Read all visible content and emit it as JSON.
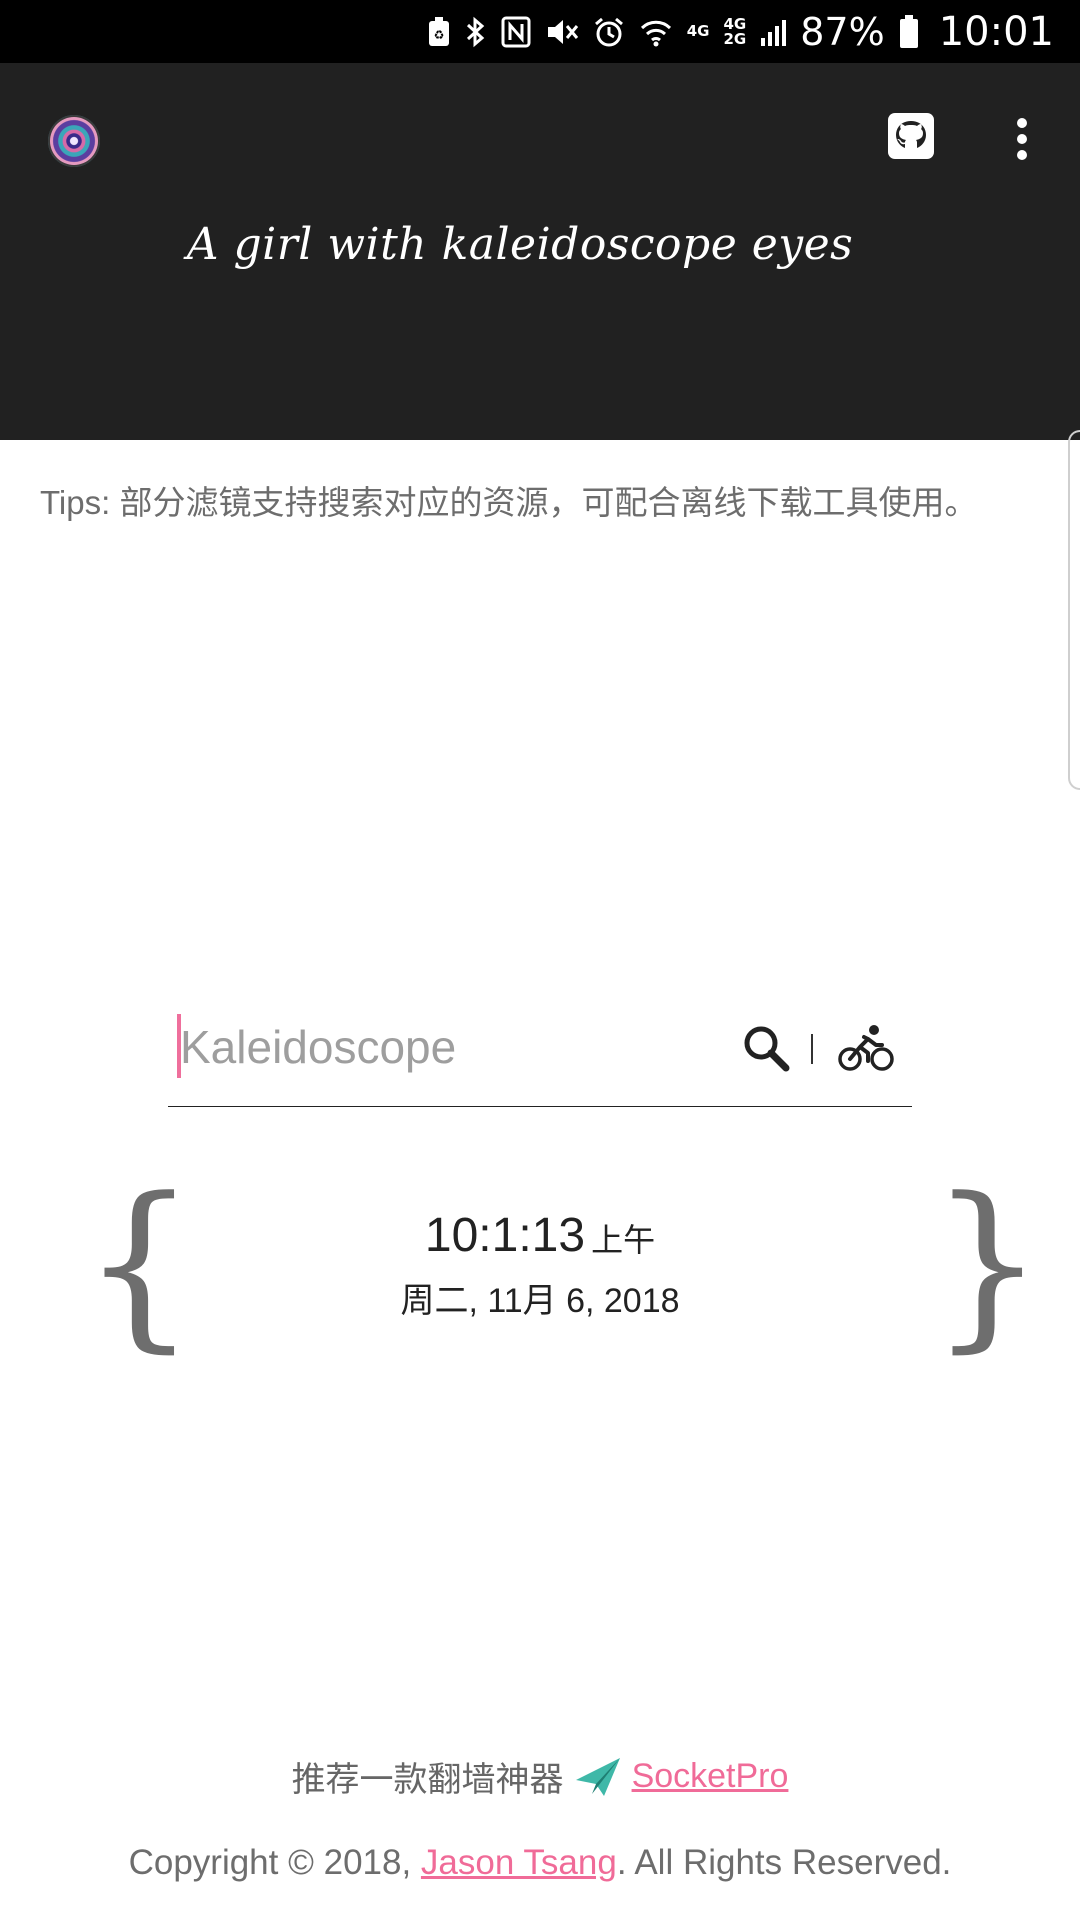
{
  "status_bar": {
    "net_top": "4G",
    "net_mid": "4G",
    "net_bottom": "2G",
    "battery_percent": "87%",
    "battery_level": 0.87,
    "time": "10:01"
  },
  "header": {
    "title": "A girl with kaleidoscope eyes",
    "logo_icon": "kaleidoscope-logo-icon",
    "github_icon": "github-icon",
    "more_icon": "more-vert-icon"
  },
  "tips": {
    "text": "Tips: 部分滤镜支持搜索对应的资源，可配合离线下载工具使用。"
  },
  "search": {
    "placeholder": "Kaleidoscope",
    "value": "",
    "search_icon": "search-icon",
    "bike_icon": "bicycle-icon",
    "accent_color": "#ef6f9c"
  },
  "clock": {
    "time": "10:1:13",
    "ampm": "上午",
    "date": "周二, 11月 6, 2018",
    "left_brace": "{",
    "right_brace": "}"
  },
  "footer": {
    "promo_text": "推荐一款翻墙神器",
    "promo_icon": "paper-plane-icon",
    "promo_link": "SocketPro",
    "copyright_prefix": "Copyright © 2018, ",
    "author_link": "Jason Tsang",
    "copyright_suffix": ". All Rights Reserved.",
    "link_color": "#f06b98"
  }
}
